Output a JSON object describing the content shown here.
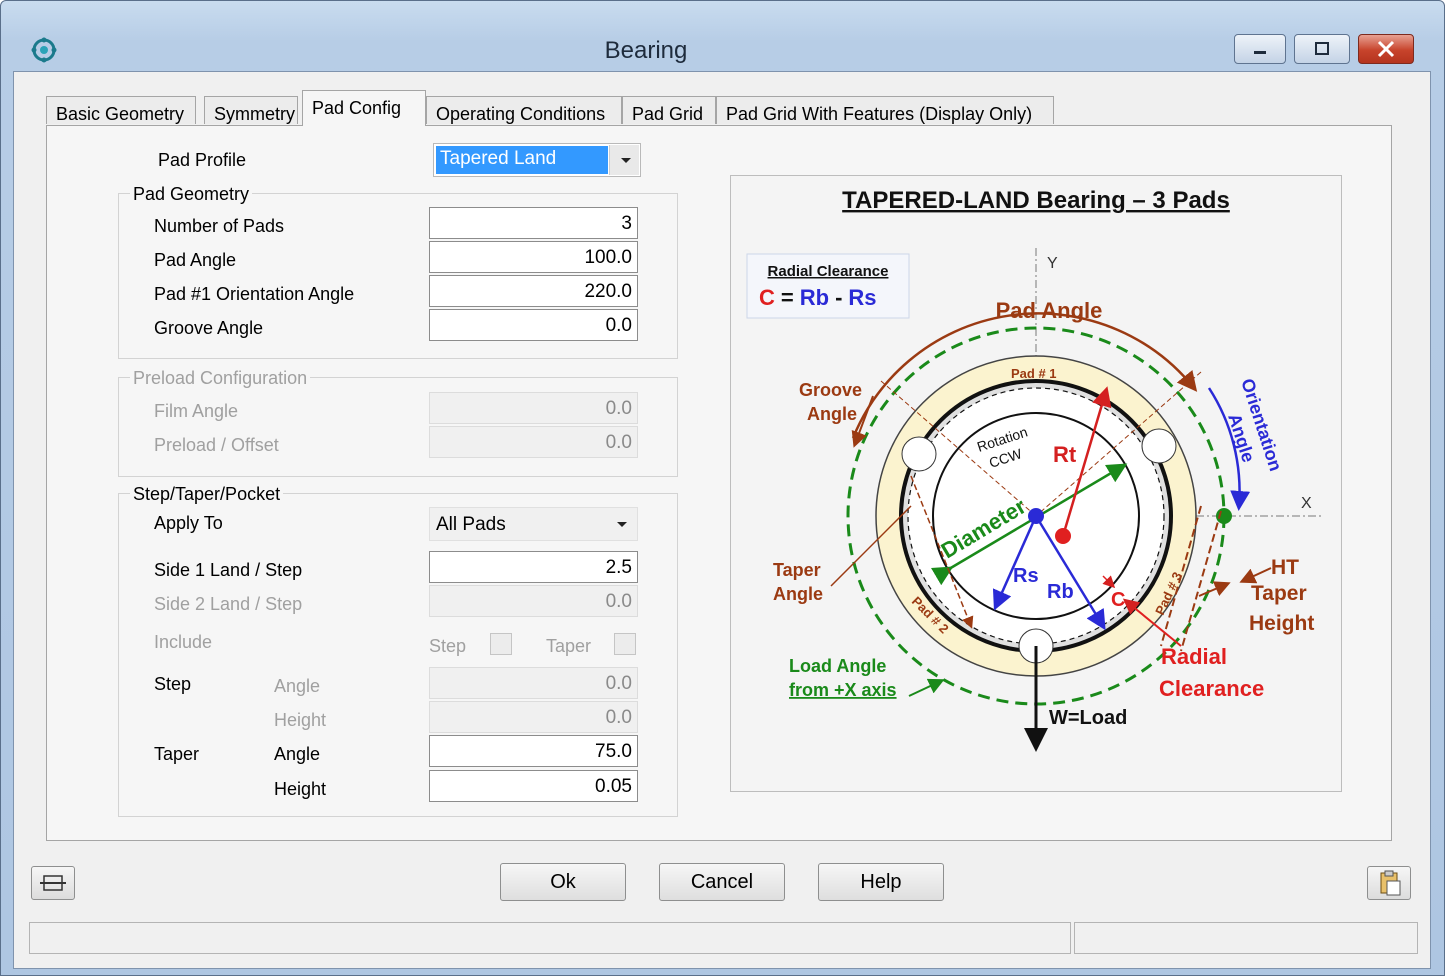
{
  "window": {
    "title": "Bearing"
  },
  "tabs": [
    {
      "label": "Basic Geometry"
    },
    {
      "label": "Symmetry"
    },
    {
      "label": "Pad Config"
    },
    {
      "label": "Operating Conditions"
    },
    {
      "label": "Pad Grid"
    },
    {
      "label": "Pad Grid With Features (Display Only)"
    }
  ],
  "form": {
    "pad_profile_label": "Pad Profile",
    "pad_profile_value": "Tapered Land",
    "pad_geometry": {
      "title": "Pad Geometry",
      "number_of_pads_label": "Number of Pads",
      "number_of_pads": "3",
      "pad_angle_label": "Pad Angle",
      "pad_angle": "100.0",
      "orientation_label": "Pad #1 Orientation Angle",
      "orientation": "220.0",
      "groove_label": "Groove Angle",
      "groove": "0.0"
    },
    "preload": {
      "title": "Preload Configuration",
      "film_angle_label": "Film Angle",
      "film_angle": "0.0",
      "offset_label": "Preload / Offset",
      "offset": "0.0"
    },
    "step_taper": {
      "title": "Step/Taper/Pocket",
      "apply_to_label": "Apply To",
      "apply_to": "All Pads",
      "side1_label": "Side 1 Land / Step",
      "side1": "2.5",
      "side2_label": "Side 2 Land / Step",
      "side2": "0.0",
      "include_label": "Include",
      "include_step": "Step",
      "include_taper": "Taper",
      "step_label": "Step",
      "step_angle_label": "Angle",
      "step_angle": "0.0",
      "step_height_label": "Height",
      "step_height": "0.0",
      "taper_label": "Taper",
      "taper_angle_label": "Angle",
      "taper_angle": "75.0",
      "taper_height_label": "Height",
      "taper_height": "0.05"
    }
  },
  "diagram": {
    "title": "TAPERED-LAND Bearing – 3 Pads",
    "clearance_box_title": "Radial Clearance",
    "eq_c": "C",
    "eq_eq": "=",
    "eq_rb": "Rb",
    "eq_minus": "-",
    "eq_rs": "Rs",
    "pad_angle": "Pad Angle",
    "groove_1": "Groove",
    "groove_2": "Angle",
    "orientation_1": "Orientation",
    "orientation_2": "Angle",
    "rotation_1": "Rotation",
    "rotation_2": "CCW",
    "rt": "Rt",
    "diameter": "Diameter",
    "rs": "Rs",
    "rb": "Rb",
    "c": "C",
    "x_axis": "X",
    "y_axis": "Y",
    "taper_angle_1": "Taper",
    "taper_angle_2": "Angle",
    "ht_1": "HT",
    "ht_2": "Taper",
    "ht_3": "Height",
    "radial_1": "Radial",
    "radial_2": "Clearance",
    "load_angle_1": "Load Angle",
    "load_angle_2": "from +X axis",
    "load": "W=Load",
    "pad1": "Pad # 1",
    "pad2": "Pad # 2",
    "pad3": "Pad # 3"
  },
  "buttons": {
    "ok": "Ok",
    "cancel": "Cancel",
    "help": "Help"
  },
  "colors": {
    "accent": "#3399ff",
    "brown": "#9b3a12",
    "green": "#1a8a1a",
    "blue": "#2a2ad6",
    "red": "#e02020"
  }
}
